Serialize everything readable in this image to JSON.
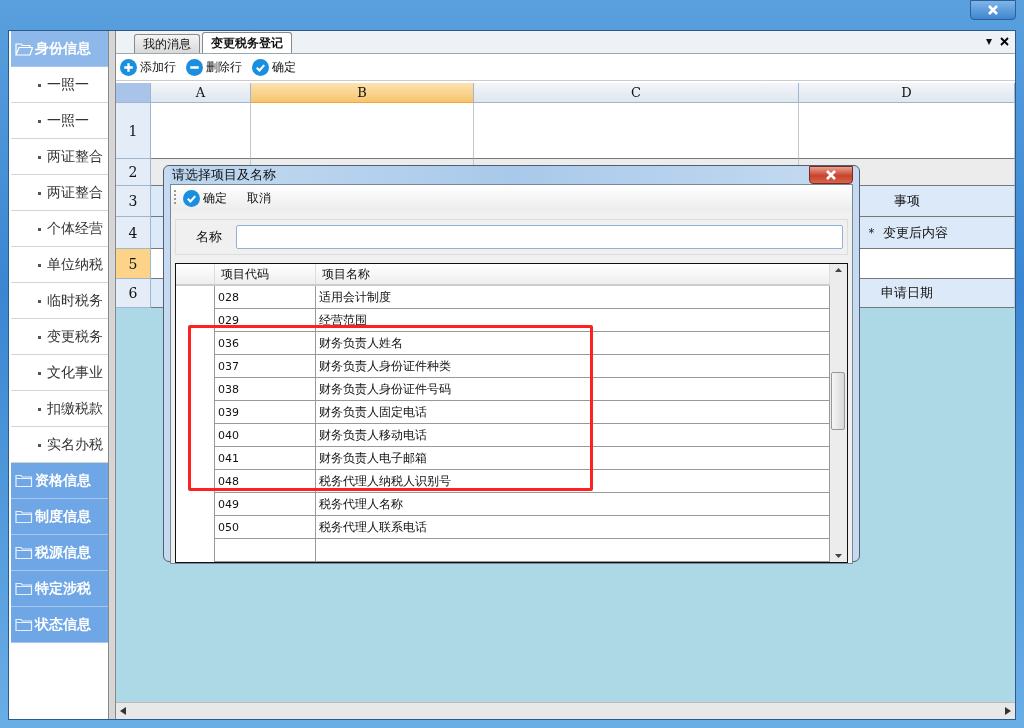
{
  "sidebar": {
    "groups": [
      {
        "label": "身份信息",
        "expanded": true,
        "items": [
          "一照一",
          "一照一",
          "两证整合",
          "两证整合",
          "个体经营",
          "单位纳税",
          "临时税务",
          "变更税务",
          "文化事业",
          "扣缴税款",
          "实名办税"
        ]
      },
      {
        "label": "资格信息",
        "expanded": false
      },
      {
        "label": "制度信息",
        "expanded": false
      },
      {
        "label": "税源信息",
        "expanded": false
      },
      {
        "label": "特定涉税",
        "expanded": false
      },
      {
        "label": "状态信息",
        "expanded": false
      }
    ]
  },
  "tabs": [
    {
      "label": "我的消息",
      "selected": false
    },
    {
      "label": "变更税务登记",
      "selected": true
    }
  ],
  "tab_menu": "▾",
  "toolbar": [
    {
      "kind": "add",
      "label": "添加行"
    },
    {
      "kind": "remove",
      "label": "删除行"
    },
    {
      "kind": "confirm",
      "label": "确定"
    }
  ],
  "sheet": {
    "columns": [
      {
        "label": "A",
        "selected": false
      },
      {
        "label": "B",
        "selected": true
      },
      {
        "label": "C",
        "selected": false
      },
      {
        "label": "D",
        "selected": false
      }
    ],
    "rows": [
      {
        "label": "1",
        "selected": false
      },
      {
        "label": "2",
        "selected": false
      },
      {
        "label": "3",
        "selected": false,
        "column_d": "事项"
      },
      {
        "label": "4",
        "selected": false,
        "column_d": "＊ 变更后内容"
      },
      {
        "label": "5",
        "selected": true
      },
      {
        "label": "6",
        "selected": false,
        "column_d": "申请日期"
      }
    ]
  },
  "dialog": {
    "title": "请选择项目及名称",
    "toolbar": [
      {
        "kind": "confirm",
        "label": "确定"
      },
      {
        "kind": "plain",
        "label": "取消"
      }
    ],
    "name_field": {
      "label": "名称"
    },
    "list": {
      "columns": [
        "项目代码",
        "项目名称"
      ],
      "rows": [
        {
          "code": "028",
          "name": "适用会计制度"
        },
        {
          "code": "029",
          "name": "经营范围"
        },
        {
          "code": "036",
          "name": "财务负责人姓名"
        },
        {
          "code": "037",
          "name": "财务负责人身份证件种类"
        },
        {
          "code": "038",
          "name": "财务负责人身份证件号码"
        },
        {
          "code": "039",
          "name": "财务负责人固定电话"
        },
        {
          "code": "040",
          "name": "财务负责人移动电话"
        },
        {
          "code": "041",
          "name": "财务负责人电子邮箱"
        },
        {
          "code": "048",
          "name": "税务代理人纳税人识别号"
        },
        {
          "code": "049",
          "name": "税务代理人名称"
        },
        {
          "code": "050",
          "name": "税务代理人联系电话"
        }
      ]
    }
  }
}
